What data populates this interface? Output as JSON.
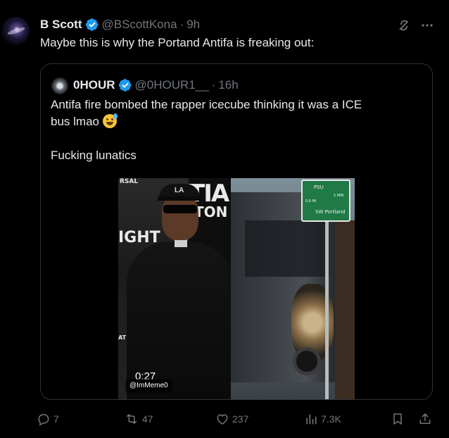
{
  "tweet": {
    "author_name": "B Scott",
    "handle": "@BScottKona",
    "separator": "·",
    "time": "9h",
    "text": "Maybe this is why the Portand Antifa is freaking out:",
    "icons": {
      "verified": "verified-badge-icon",
      "grok": "grok-icon",
      "more": "more-icon"
    }
  },
  "quote": {
    "author_name": "0HOUR",
    "handle": "@0HOUR1__",
    "separator": "·",
    "time": "16h",
    "text_line1": "Antifa fire bombed the rapper icecube thinking it was a ICE",
    "text_line2": "bus lmao",
    "text_emoji": "grinning-sweat-emoji",
    "text_line3": "Fucking lunatics",
    "media": {
      "duration": "0:27",
      "watermark": "@ImMeme0",
      "left_background_texts": [
        "RSAL",
        "TIA",
        "TON",
        "IGHT",
        "AT"
      ],
      "cap_logo": "LA",
      "sign_texts": [
        "PSU",
        "5 MIN",
        "0.8 MI",
        "SW Portland"
      ]
    }
  },
  "actions": {
    "reply_count": "7",
    "repost_count": "47",
    "like_count": "237",
    "views_count": "7.3K"
  },
  "colors": {
    "background": "#000000",
    "primary_text": "#e7e9ea",
    "secondary_text": "#71767b",
    "border": "#2f3336",
    "verified": "#1d9bf0"
  }
}
